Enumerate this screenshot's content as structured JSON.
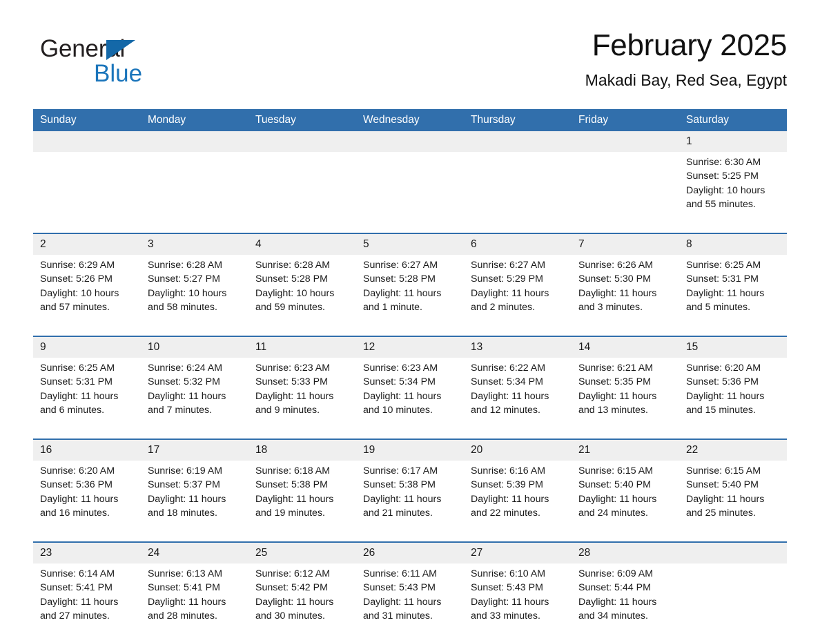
{
  "brand": {
    "name_part1": "General",
    "name_part2": "Blue",
    "triangle_icon": "triangle-icon",
    "accent_blue": "#1b75bb"
  },
  "header": {
    "month_title": "February 2025",
    "location": "Makadi Bay, Red Sea, Egypt"
  },
  "colors": {
    "header_blue": "#316fac",
    "daynum_grey": "#efefef",
    "text": "#1a1a1a"
  },
  "weekday_headers": [
    "Sunday",
    "Monday",
    "Tuesday",
    "Wednesday",
    "Thursday",
    "Friday",
    "Saturday"
  ],
  "labels": {
    "sunrise": "Sunrise:",
    "sunset": "Sunset:",
    "daylight": "Daylight:"
  },
  "weeks": [
    [
      {
        "day": "",
        "empty": true
      },
      {
        "day": "",
        "empty": true
      },
      {
        "day": "",
        "empty": true
      },
      {
        "day": "",
        "empty": true
      },
      {
        "day": "",
        "empty": true
      },
      {
        "day": "",
        "empty": true
      },
      {
        "day": "1",
        "sunrise": "Sunrise: 6:30 AM",
        "sunset": "Sunset: 5:25 PM",
        "daylight": "Daylight: 10 hours and 55 minutes."
      }
    ],
    [
      {
        "day": "2",
        "sunrise": "Sunrise: 6:29 AM",
        "sunset": "Sunset: 5:26 PM",
        "daylight": "Daylight: 10 hours and 57 minutes."
      },
      {
        "day": "3",
        "sunrise": "Sunrise: 6:28 AM",
        "sunset": "Sunset: 5:27 PM",
        "daylight": "Daylight: 10 hours and 58 minutes."
      },
      {
        "day": "4",
        "sunrise": "Sunrise: 6:28 AM",
        "sunset": "Sunset: 5:28 PM",
        "daylight": "Daylight: 10 hours and 59 minutes."
      },
      {
        "day": "5",
        "sunrise": "Sunrise: 6:27 AM",
        "sunset": "Sunset: 5:28 PM",
        "daylight": "Daylight: 11 hours and 1 minute."
      },
      {
        "day": "6",
        "sunrise": "Sunrise: 6:27 AM",
        "sunset": "Sunset: 5:29 PM",
        "daylight": "Daylight: 11 hours and 2 minutes."
      },
      {
        "day": "7",
        "sunrise": "Sunrise: 6:26 AM",
        "sunset": "Sunset: 5:30 PM",
        "daylight": "Daylight: 11 hours and 3 minutes."
      },
      {
        "day": "8",
        "sunrise": "Sunrise: 6:25 AM",
        "sunset": "Sunset: 5:31 PM",
        "daylight": "Daylight: 11 hours and 5 minutes."
      }
    ],
    [
      {
        "day": "9",
        "sunrise": "Sunrise: 6:25 AM",
        "sunset": "Sunset: 5:31 PM",
        "daylight": "Daylight: 11 hours and 6 minutes."
      },
      {
        "day": "10",
        "sunrise": "Sunrise: 6:24 AM",
        "sunset": "Sunset: 5:32 PM",
        "daylight": "Daylight: 11 hours and 7 minutes."
      },
      {
        "day": "11",
        "sunrise": "Sunrise: 6:23 AM",
        "sunset": "Sunset: 5:33 PM",
        "daylight": "Daylight: 11 hours and 9 minutes."
      },
      {
        "day": "12",
        "sunrise": "Sunrise: 6:23 AM",
        "sunset": "Sunset: 5:34 PM",
        "daylight": "Daylight: 11 hours and 10 minutes."
      },
      {
        "day": "13",
        "sunrise": "Sunrise: 6:22 AM",
        "sunset": "Sunset: 5:34 PM",
        "daylight": "Daylight: 11 hours and 12 minutes."
      },
      {
        "day": "14",
        "sunrise": "Sunrise: 6:21 AM",
        "sunset": "Sunset: 5:35 PM",
        "daylight": "Daylight: 11 hours and 13 minutes."
      },
      {
        "day": "15",
        "sunrise": "Sunrise: 6:20 AM",
        "sunset": "Sunset: 5:36 PM",
        "daylight": "Daylight: 11 hours and 15 minutes."
      }
    ],
    [
      {
        "day": "16",
        "sunrise": "Sunrise: 6:20 AM",
        "sunset": "Sunset: 5:36 PM",
        "daylight": "Daylight: 11 hours and 16 minutes."
      },
      {
        "day": "17",
        "sunrise": "Sunrise: 6:19 AM",
        "sunset": "Sunset: 5:37 PM",
        "daylight": "Daylight: 11 hours and 18 minutes."
      },
      {
        "day": "18",
        "sunrise": "Sunrise: 6:18 AM",
        "sunset": "Sunset: 5:38 PM",
        "daylight": "Daylight: 11 hours and 19 minutes."
      },
      {
        "day": "19",
        "sunrise": "Sunrise: 6:17 AM",
        "sunset": "Sunset: 5:38 PM",
        "daylight": "Daylight: 11 hours and 21 minutes."
      },
      {
        "day": "20",
        "sunrise": "Sunrise: 6:16 AM",
        "sunset": "Sunset: 5:39 PM",
        "daylight": "Daylight: 11 hours and 22 minutes."
      },
      {
        "day": "21",
        "sunrise": "Sunrise: 6:15 AM",
        "sunset": "Sunset: 5:40 PM",
        "daylight": "Daylight: 11 hours and 24 minutes."
      },
      {
        "day": "22",
        "sunrise": "Sunrise: 6:15 AM",
        "sunset": "Sunset: 5:40 PM",
        "daylight": "Daylight: 11 hours and 25 minutes."
      }
    ],
    [
      {
        "day": "23",
        "sunrise": "Sunrise: 6:14 AM",
        "sunset": "Sunset: 5:41 PM",
        "daylight": "Daylight: 11 hours and 27 minutes."
      },
      {
        "day": "24",
        "sunrise": "Sunrise: 6:13 AM",
        "sunset": "Sunset: 5:41 PM",
        "daylight": "Daylight: 11 hours and 28 minutes."
      },
      {
        "day": "25",
        "sunrise": "Sunrise: 6:12 AM",
        "sunset": "Sunset: 5:42 PM",
        "daylight": "Daylight: 11 hours and 30 minutes."
      },
      {
        "day": "26",
        "sunrise": "Sunrise: 6:11 AM",
        "sunset": "Sunset: 5:43 PM",
        "daylight": "Daylight: 11 hours and 31 minutes."
      },
      {
        "day": "27",
        "sunrise": "Sunrise: 6:10 AM",
        "sunset": "Sunset: 5:43 PM",
        "daylight": "Daylight: 11 hours and 33 minutes."
      },
      {
        "day": "28",
        "sunrise": "Sunrise: 6:09 AM",
        "sunset": "Sunset: 5:44 PM",
        "daylight": "Daylight: 11 hours and 34 minutes."
      },
      {
        "day": "",
        "empty": true
      }
    ]
  ]
}
